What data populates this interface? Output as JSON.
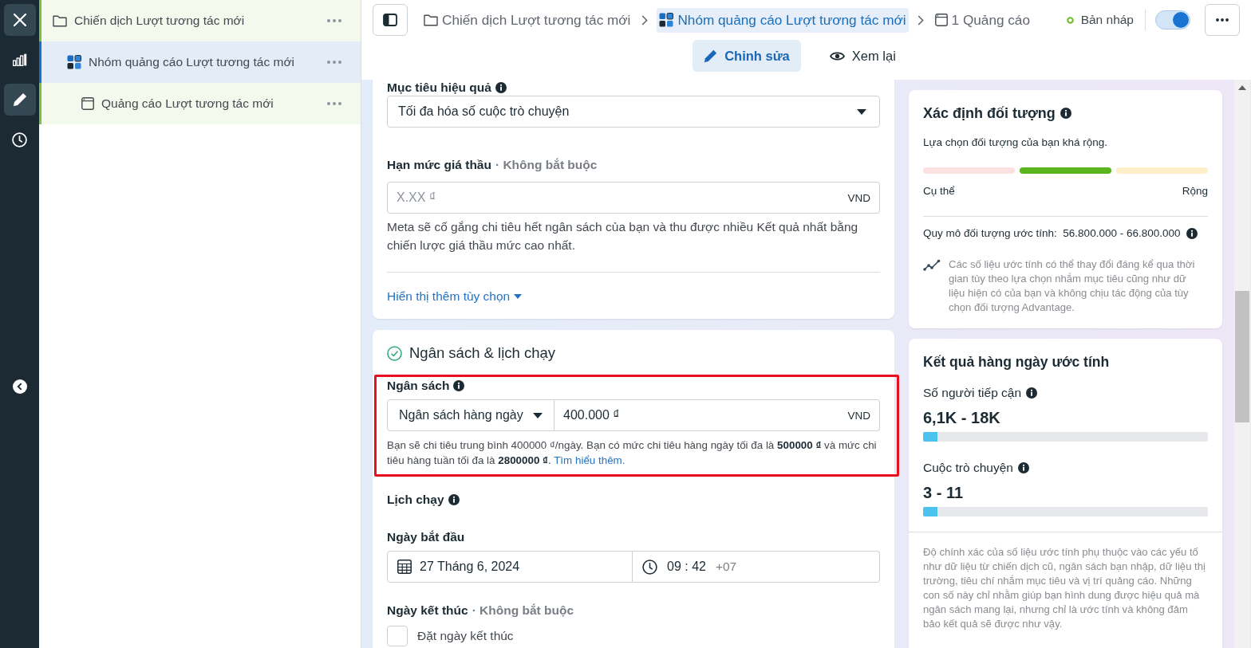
{
  "rail": {
    "items": [
      {
        "kind": "reports",
        "selected": false
      },
      {
        "kind": "edit",
        "selected": true
      },
      {
        "kind": "history",
        "selected": false
      }
    ]
  },
  "tree": [
    {
      "kind": "campaign",
      "label": "Chiến dịch Lượt tương tác mới",
      "selected": false,
      "children": [
        {
          "kind": "ad_set",
          "label": "Nhóm quảng cáo Lượt tương tác mới",
          "selected": true,
          "children": [
            {
              "kind": "ad",
              "label": "Quảng cáo Lượt tương tác mới",
              "selected": false
            }
          ]
        }
      ]
    }
  ],
  "header": {
    "breadcrumbs": [
      {
        "kind": "campaign",
        "label": "Chiến dịch Lượt tương tác mới",
        "selected": false
      },
      {
        "kind": "ad_set",
        "label": "Nhóm quảng cáo Lượt tương tác mới",
        "selected": true
      },
      {
        "kind": "ad",
        "label": "1 Quảng cáo",
        "selected": false
      }
    ],
    "status": "Bản nháp",
    "toggle": {
      "on": true
    },
    "tabs": [
      {
        "kind": "edit",
        "label": "Chỉnh sửa",
        "selected": true
      },
      {
        "kind": "review",
        "label": "Xem lại",
        "selected": false
      }
    ]
  },
  "delivery_card": {
    "goal": {
      "label": "Mục tiêu hiệu quả",
      "value": "Tối đa hóa số cuộc trò chuyện"
    },
    "bid_cap": {
      "label": "Hạn mức giá thầu",
      "optional": "· Không bắt buộc",
      "placeholder": "X.XX ₫",
      "currency": "VND",
      "help": "Meta sẽ cố gắng chi tiêu hết ngân sách của bạn và thu được nhiều Kết quả nhất bằng chiến lược giá thầu mức cao nhất."
    },
    "more_options": "Hiển thị thêm tùy chọn"
  },
  "budget_card": {
    "title": "Ngân sách & lịch chạy",
    "complete": true,
    "budget": {
      "label": "Ngân sách",
      "highlighted": true,
      "type": "Ngân sách hàng ngày",
      "amount": "400.000 ₫",
      "currency": "VND",
      "note": "Bạn sẽ chi tiêu trung bình 400000 ₫/ngày. Bạn có mức chi tiêu hàng ngày tối đa là **500000 ₫** và mức chi tiêu hàng tuần tối đa là **2800000 ₫**.",
      "link": "Tìm hiểu thêm."
    },
    "schedule": {
      "label": "Lịch chạy",
      "start": {
        "label": "Ngày bắt đầu",
        "date": "27 Tháng 6, 2024",
        "time": "09 : 42",
        "timezone": "+07"
      },
      "end": {
        "label": "Ngày kết thúc",
        "optional": "· Không bắt buộc",
        "checkbox": "Đặt ngày kết thúc",
        "checked": false
      }
    }
  },
  "audience": {
    "title": "Xác định đối tượng",
    "summary": "Lựa chọn đối tượng của bạn khá rộng.",
    "segments": [
      {
        "color": "#fbe1df"
      },
      {
        "color": "#5cb51c"
      },
      {
        "color": "#fdefc8"
      }
    ],
    "min_label": "Cụ thể",
    "max_label": "Rộng",
    "size": "Quy mô đối tượng ước tính:  56.800.000 - 66.800.000",
    "disclaimer": "Các số liệu ước tính có thể thay đổi đáng kể qua thời gian tùy theo lựa chọn nhắm mục tiêu cũng như dữ liệu hiện có của bạn và không chịu tác động của tùy chọn đối tượng Advantage."
  },
  "estimates": {
    "title": "Kết quả hàng ngày ước tính",
    "metrics": [
      {
        "label": "Số người tiếp cận",
        "value": "6,1K - 18K",
        "level": 0.05
      },
      {
        "label": "Cuộc trò chuyện",
        "value": "3 - 11",
        "level": 0.05
      }
    ],
    "disclaimer": "Độ chính xác của số liệu ước tính phụ thuộc vào các yếu tố như dữ liệu từ chiến dịch cũ, ngân sách bạn nhập, dữ liệu thị trường, tiêu chí nhắm mục tiêu và vị trí quảng cáo. Những con số này chỉ nhằm giúp bạn hình dung được hiệu quả mà ngân sách mang lại, nhưng chỉ là ước tính và không đảm bảo kết quả sẽ được như vậy."
  }
}
